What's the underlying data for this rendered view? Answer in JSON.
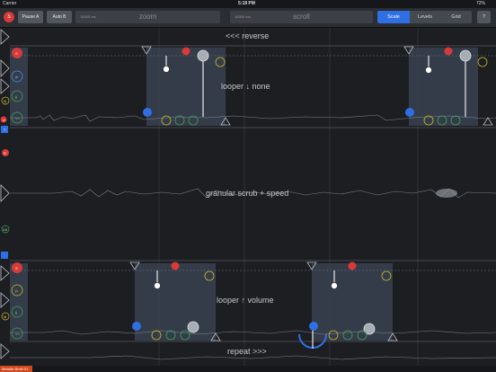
{
  "status": {
    "carrier": "Carrier",
    "time": "5:18 PM",
    "battery": "72%"
  },
  "toolbar": {
    "s_badge": "S",
    "pause_a": "Pause A",
    "auto_b": "Auto B",
    "zoom_small": "10000 ms",
    "zoom_label": "zoom",
    "scroll_small": "10000 ms",
    "scroll_label": "scroll",
    "tabs": [
      "Scale",
      "Levels",
      "Grid"
    ],
    "help": "?"
  },
  "tracks": {
    "reverse": "<<< reverse",
    "looper_none": "looper ↓ none",
    "granular": "granular scrub + speed",
    "looper_volume": "looper ↑ volume",
    "repeat": "repeat >>>"
  },
  "side_badges": {
    "s": "S",
    "ib": "|b",
    "ii": "||",
    "m": "M",
    "a": "A",
    "ll": "<<",
    "t": "T",
    "r": "R",
    "ab": "AB",
    "li": "|>"
  },
  "bottom": {
    "tag": "Metallic Bmbl 01"
  },
  "colors": {
    "accent": "#2f6fe4",
    "red": "#d63a3a",
    "yellow": "#c9b928",
    "green": "#3da35a",
    "blue_badge": "#2f6fe4"
  }
}
